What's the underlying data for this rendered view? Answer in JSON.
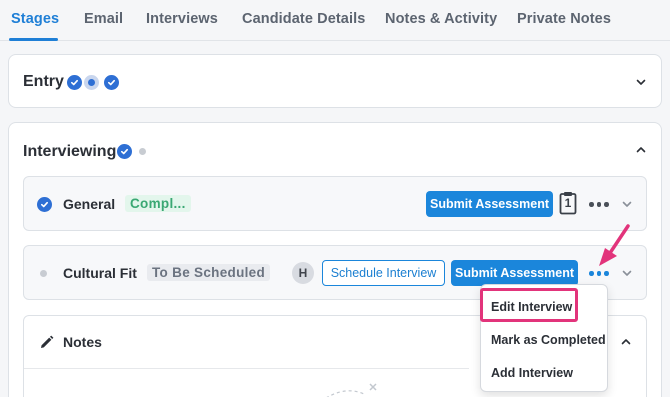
{
  "tabs": [
    {
      "label": "Stages",
      "active": true
    },
    {
      "label": "Email"
    },
    {
      "label": "Interviews"
    },
    {
      "label": "Candidate Details"
    },
    {
      "label": "Notes & Activity"
    },
    {
      "label": "Private Notes"
    }
  ],
  "entry": {
    "title": "Entry"
  },
  "interviewing": {
    "title": "Interviewing",
    "general": {
      "title": "General",
      "status": "Compl...",
      "submit_label": "Submit Assessment",
      "count": "1"
    },
    "cultural_fit": {
      "title": "Cultural Fit",
      "status": "To Be Scheduled",
      "avatar_initial": "H",
      "schedule_label": "Schedule Interview",
      "submit_label": "Submit Assessment"
    },
    "notes": {
      "title": "Notes"
    }
  },
  "menu": {
    "items": [
      "Edit Interview",
      "Mark as Completed",
      "Add Interview"
    ]
  },
  "colors": {
    "accent": "#1b86db",
    "check": "#2e6fd4",
    "highlight": "#e2347b",
    "status_green": "#3aa873"
  }
}
